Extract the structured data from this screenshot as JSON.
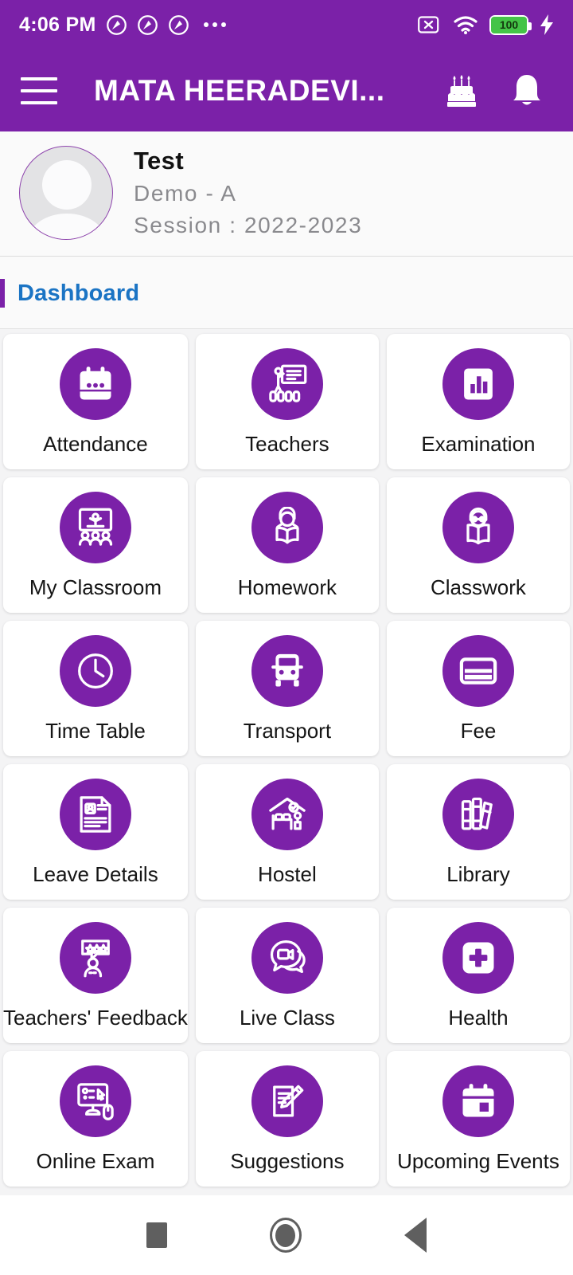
{
  "statusbar": {
    "time": "4:06 PM",
    "app_icons": [
      "circle-slash-icon",
      "circle-slash-icon",
      "circle-slash-icon"
    ],
    "overflow": "more-icon",
    "sim_icon": "sim-card-off-icon",
    "wifi_icon": "wifi-icon",
    "battery_level": "100",
    "battery_color": "#44C447",
    "charging_icon": "charging-bolt-icon"
  },
  "appbar": {
    "menu_icon": "hamburger-menu-icon",
    "title": "MATA HEERADEVI...",
    "birthday_icon": "birthday-cake-icon",
    "notification_icon": "bell-icon",
    "background_color": "#7B21A8"
  },
  "profile": {
    "avatar_icon": "user-avatar-placeholder",
    "name": "Test",
    "class": "Demo - A",
    "session": "Session : 2022-2023"
  },
  "dashboard": {
    "title": "Dashboard",
    "title_color": "#1B74C4",
    "accent_color": "#7B21A8"
  },
  "tiles": [
    {
      "label": "Attendance",
      "icon": "calendar-icon"
    },
    {
      "label": "Teachers",
      "icon": "teacher-presentation-icon"
    },
    {
      "label": "Examination",
      "icon": "bar-chart-icon"
    },
    {
      "label": "My Classroom",
      "icon": "classroom-icon"
    },
    {
      "label": "Homework",
      "icon": "student-reading-icon"
    },
    {
      "label": "Classwork",
      "icon": "open-book-reader-icon"
    },
    {
      "label": "Time Table",
      "icon": "clock-icon"
    },
    {
      "label": "Transport",
      "icon": "bus-icon"
    },
    {
      "label": "Fee",
      "icon": "credit-card-icon"
    },
    {
      "label": "Leave Details",
      "icon": "document-profile-icon"
    },
    {
      "label": "Hostel",
      "icon": "hostel-bed-icon"
    },
    {
      "label": "Library",
      "icon": "books-icon"
    },
    {
      "label": "Teachers' Feedback",
      "icon": "feedback-stars-icon"
    },
    {
      "label": "Live Class",
      "icon": "video-chat-icon"
    },
    {
      "label": "Health",
      "icon": "medical-cross-icon"
    },
    {
      "label": "Online Exam",
      "icon": "online-exam-monitor-icon"
    },
    {
      "label": "Suggestions",
      "icon": "notepad-pencil-icon"
    },
    {
      "label": "Upcoming Events",
      "icon": "calendar-event-icon"
    }
  ],
  "navbar": {
    "recents": "recents-square-icon",
    "home": "home-circle-icon",
    "back": "back-triangle-icon"
  }
}
